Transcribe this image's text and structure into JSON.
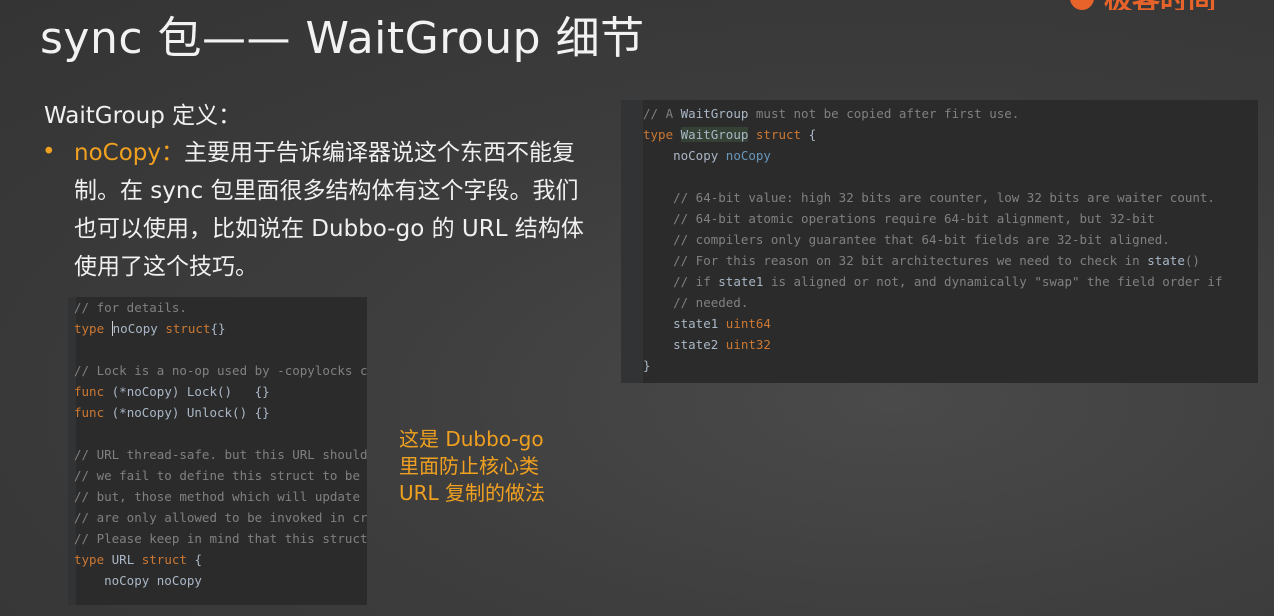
{
  "slide": {
    "title": "sync 包—— WaitGroup 细节",
    "logo_text": "极客时间",
    "subtitle": "WaitGroup 定义：",
    "bullet": {
      "highlight": "noCopy：",
      "text": "主要用于告诉编译器说这个东西不能复制。在 sync 包里面很多结构体有这个字段。我们也可以使用，比如说在 Dubbo-go 的 URL 结构体使用了这个技巧。"
    },
    "note": [
      "这是 Dubbo-go",
      "里面防止核心类",
      "URL 复制的做法"
    ]
  },
  "code_left": {
    "lines": [
      {
        "parts": [
          {
            "cls": "c",
            "text": "// for details."
          }
        ]
      },
      {
        "parts": [
          {
            "cls": "k",
            "text": "type "
          },
          {
            "cls": "caret t",
            "text": "n"
          },
          {
            "cls": "t",
            "text": "oCopy "
          },
          {
            "cls": "k",
            "text": "struct"
          },
          {
            "cls": "t",
            "text": "{}"
          }
        ]
      },
      {
        "parts": [
          {
            "cls": "t",
            "text": ""
          }
        ]
      },
      {
        "parts": [
          {
            "cls": "c",
            "text": "// Lock is a no-op used by -copylocks c"
          }
        ]
      },
      {
        "parts": [
          {
            "cls": "k",
            "text": "func "
          },
          {
            "cls": "t",
            "text": "(*noCopy) Lock()   {}"
          }
        ]
      },
      {
        "parts": [
          {
            "cls": "k",
            "text": "func "
          },
          {
            "cls": "t",
            "text": "(*noCopy) Unlock() {}"
          }
        ]
      },
      {
        "parts": [
          {
            "cls": "t",
            "text": ""
          }
        ]
      },
      {
        "parts": [
          {
            "cls": "c",
            "text": "// URL thread-safe. but this URL should"
          }
        ]
      },
      {
        "parts": [
          {
            "cls": "c",
            "text": "// we fail to define this struct to be"
          }
        ]
      },
      {
        "parts": [
          {
            "cls": "c",
            "text": "// but, those method which will update"
          }
        ]
      },
      {
        "parts": [
          {
            "cls": "c",
            "text": "// are only allowed to be invoked in cr"
          }
        ]
      },
      {
        "parts": [
          {
            "cls": "c",
            "text": "// Please keep in mind that this struct"
          }
        ]
      },
      {
        "parts": [
          {
            "cls": "k",
            "text": "type "
          },
          {
            "cls": "t",
            "text": "URL "
          },
          {
            "cls": "k",
            "text": "struct "
          },
          {
            "cls": "t",
            "text": "{"
          }
        ]
      },
      {
        "parts": [
          {
            "cls": "t",
            "text": "    noCopy noCopy"
          }
        ]
      }
    ]
  },
  "code_right": {
    "lines": [
      {
        "parts": [
          {
            "cls": "c",
            "text": "// A "
          },
          {
            "cls": "t",
            "text": "WaitGroup"
          },
          {
            "cls": "c",
            "text": " must not be copied after first use."
          }
        ]
      },
      {
        "parts": [
          {
            "cls": "k",
            "text": "type "
          },
          {
            "cls": "hlname",
            "text": "WaitGroup"
          },
          {
            "cls": "k",
            "text": " struct "
          },
          {
            "cls": "t",
            "text": "{"
          }
        ]
      },
      {
        "parts": [
          {
            "cls": "t",
            "text": "    noCopy "
          },
          {
            "cls": "ty",
            "text": "noCopy"
          }
        ]
      },
      {
        "parts": [
          {
            "cls": "t",
            "text": ""
          }
        ]
      },
      {
        "parts": [
          {
            "cls": "c",
            "text": "    // 64-bit value: high 32 bits are counter, low 32 bits are waiter count."
          }
        ]
      },
      {
        "parts": [
          {
            "cls": "c",
            "text": "    // 64-bit atomic operations require 64-bit alignment, but 32-bit"
          }
        ]
      },
      {
        "parts": [
          {
            "cls": "c",
            "text": "    // compilers only guarantee that 64-bit fields are 32-bit aligned."
          }
        ]
      },
      {
        "parts": [
          {
            "cls": "c",
            "text": "    // For this reason on 32 bit architectures we need to check in "
          },
          {
            "cls": "t",
            "text": "state"
          },
          {
            "cls": "c",
            "text": "()"
          }
        ]
      },
      {
        "parts": [
          {
            "cls": "c",
            "text": "    // if "
          },
          {
            "cls": "t",
            "text": "state1"
          },
          {
            "cls": "c",
            "text": " is aligned or not, and dynamically \"swap\" the field order if"
          }
        ]
      },
      {
        "parts": [
          {
            "cls": "c",
            "text": "    // needed."
          }
        ]
      },
      {
        "parts": [
          {
            "cls": "t",
            "text": "    state1 "
          },
          {
            "cls": "k",
            "text": "uint64"
          }
        ]
      },
      {
        "parts": [
          {
            "cls": "t",
            "text": "    state2 "
          },
          {
            "cls": "k",
            "text": "uint32"
          }
        ]
      },
      {
        "parts": [
          {
            "cls": "t",
            "text": "}"
          }
        ]
      }
    ]
  }
}
